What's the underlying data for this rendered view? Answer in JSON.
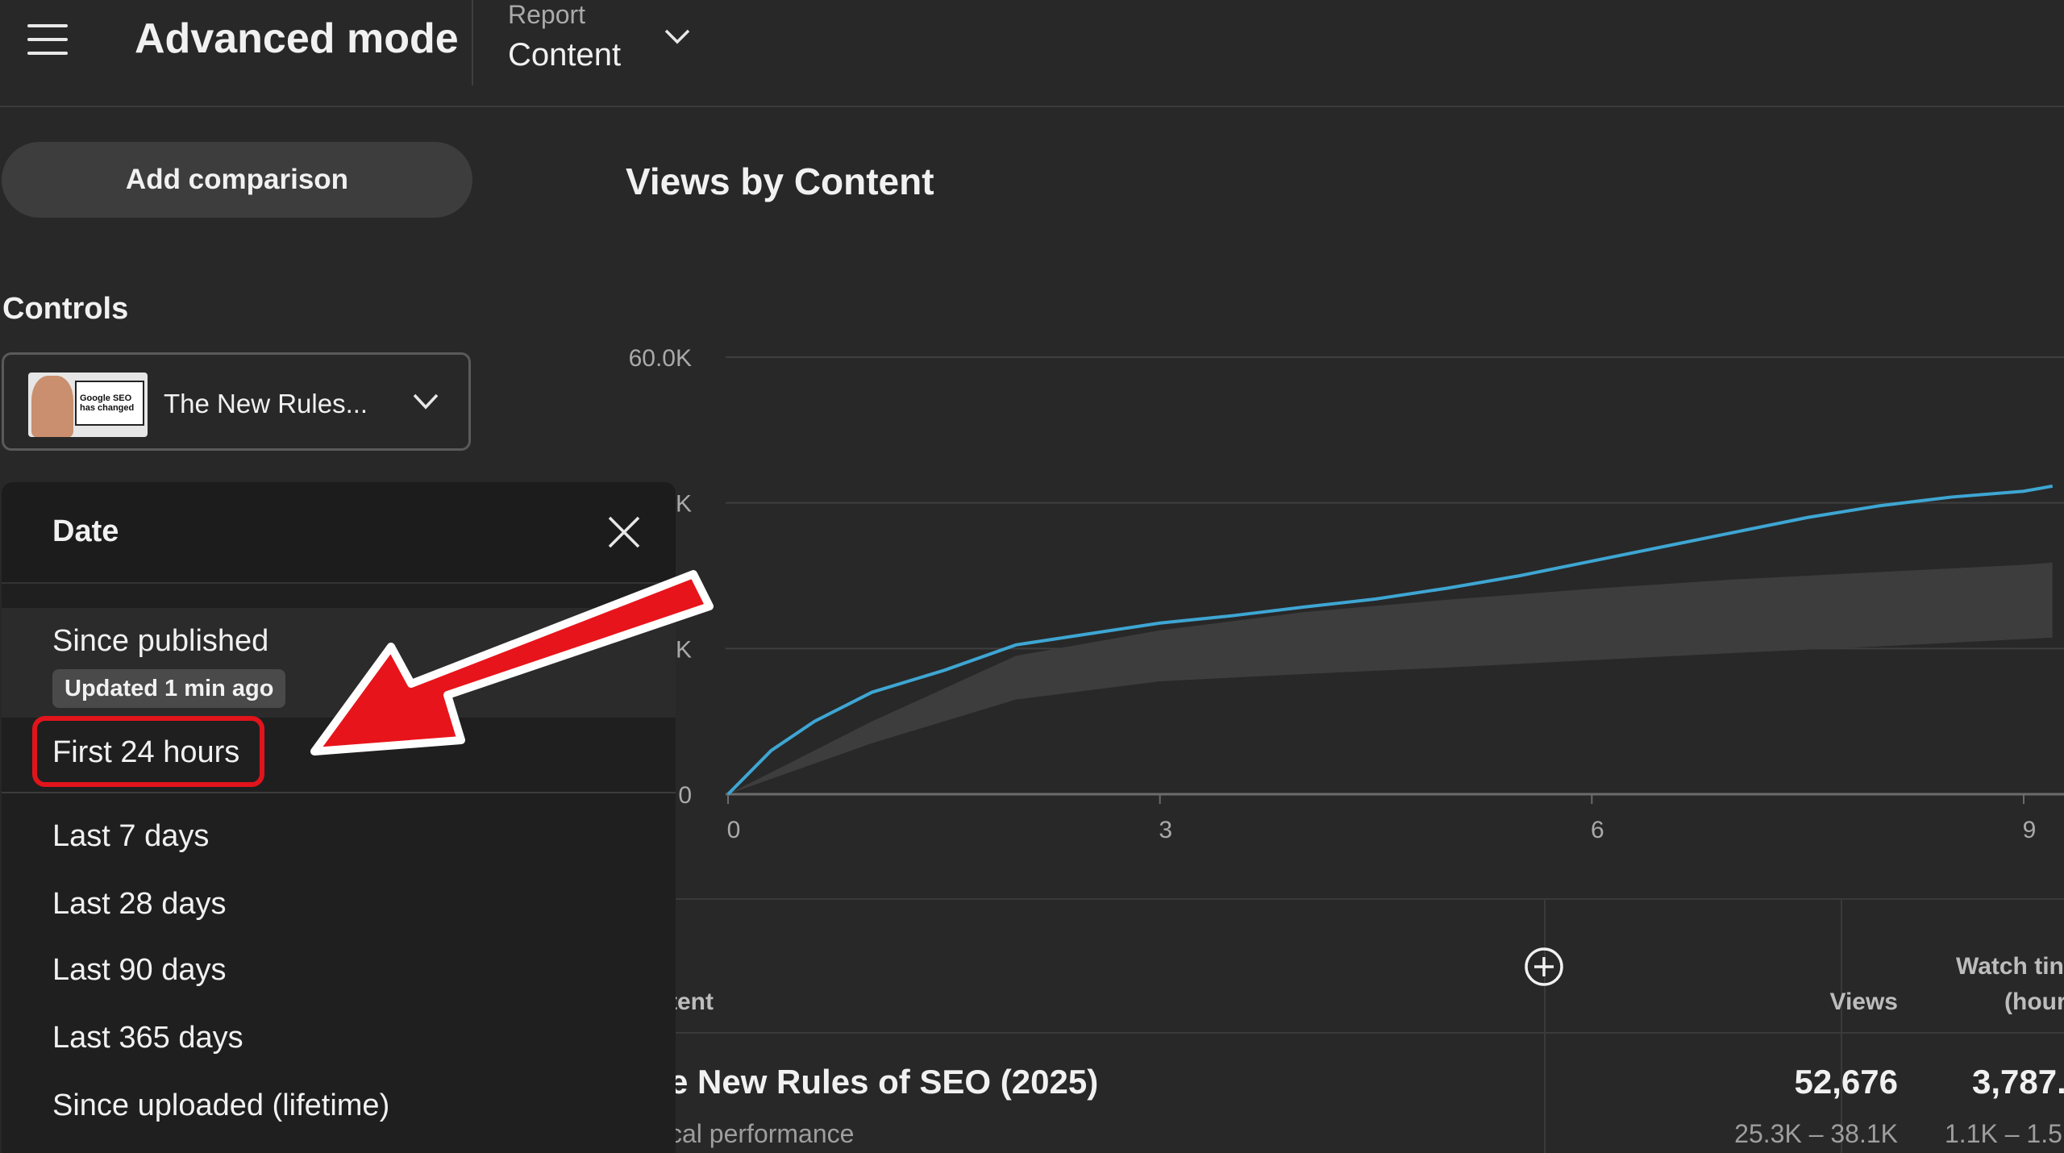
{
  "header": {
    "title": "Advanced mode",
    "report_label": "Report",
    "report_value": "Content"
  },
  "sidebar": {
    "add_comparison": "Add comparison",
    "controls_label": "Controls",
    "video_title": "The New Rules...",
    "thumbnail_text": "Google SEO has changed"
  },
  "date_panel": {
    "title": "Date",
    "options": [
      {
        "label": "Since published",
        "badge": "Updated 1 min ago"
      },
      {
        "label": "First 24 hours"
      },
      {
        "label": "Last 7 days"
      },
      {
        "label": "Last 28 days"
      },
      {
        "label": "Last 90 days"
      },
      {
        "label": "Last 365 days"
      },
      {
        "label": "Since uploaded (lifetime)"
      }
    ]
  },
  "chart_data": {
    "type": "line",
    "title": "Views by Content",
    "y_tick_labels": [
      "60.0K",
      "K",
      "K",
      "0"
    ],
    "y_ticks": [
      60000,
      40000,
      20000,
      0
    ],
    "x_ticks": [
      0,
      3,
      6,
      9
    ],
    "x_tick_labels": [
      "0",
      "3",
      "6",
      "9"
    ],
    "xlim": [
      0,
      9.2
    ],
    "ylim": [
      0,
      60000
    ],
    "grid": true,
    "line_color": "#3ea6d3",
    "band_color": "#3d3d3d",
    "series": [
      {
        "values_x": [
          0,
          0.3,
          0.6,
          1.0,
          1.5,
          2.0,
          2.5,
          3.0,
          3.5,
          4.0,
          4.5,
          5.0,
          5.5,
          6.0,
          6.5,
          7.0,
          7.5,
          8.0,
          8.5,
          9.0,
          9.2
        ],
        "values_y": [
          0,
          6000,
          10000,
          14000,
          17000,
          20500,
          22000,
          23500,
          24500,
          25700,
          26800,
          28300,
          30000,
          32000,
          34000,
          36000,
          38000,
          39600,
          40800,
          41600,
          42300
        ]
      }
    ],
    "band": {
      "x": [
        0,
        1,
        2,
        3,
        4,
        5,
        6,
        7,
        8,
        9,
        9.2
      ],
      "upper": [
        0,
        10000,
        19000,
        22500,
        25000,
        26700,
        28200,
        29500,
        30500,
        31500,
        31800
      ],
      "lower": [
        0,
        7000,
        13000,
        15500,
        16500,
        17400,
        18400,
        19400,
        20300,
        21300,
        21500
      ]
    }
  },
  "table": {
    "col_content": "tent",
    "col_views": "Views",
    "col_watch_line1": "Watch tin",
    "col_watch_line2": "(hour",
    "row": {
      "title": "e New Rules of SEO (2025)",
      "subtitle": "cal performance",
      "views": "52,676",
      "views_range": "25.3K – 38.1K",
      "watch": "3,787.",
      "watch_range": "1.1K – 1.5"
    }
  },
  "colors": {
    "background": "#282828",
    "panel": "#1f1f1f",
    "highlight_red": "#e1141c",
    "arrow_red": "#e8141b"
  }
}
